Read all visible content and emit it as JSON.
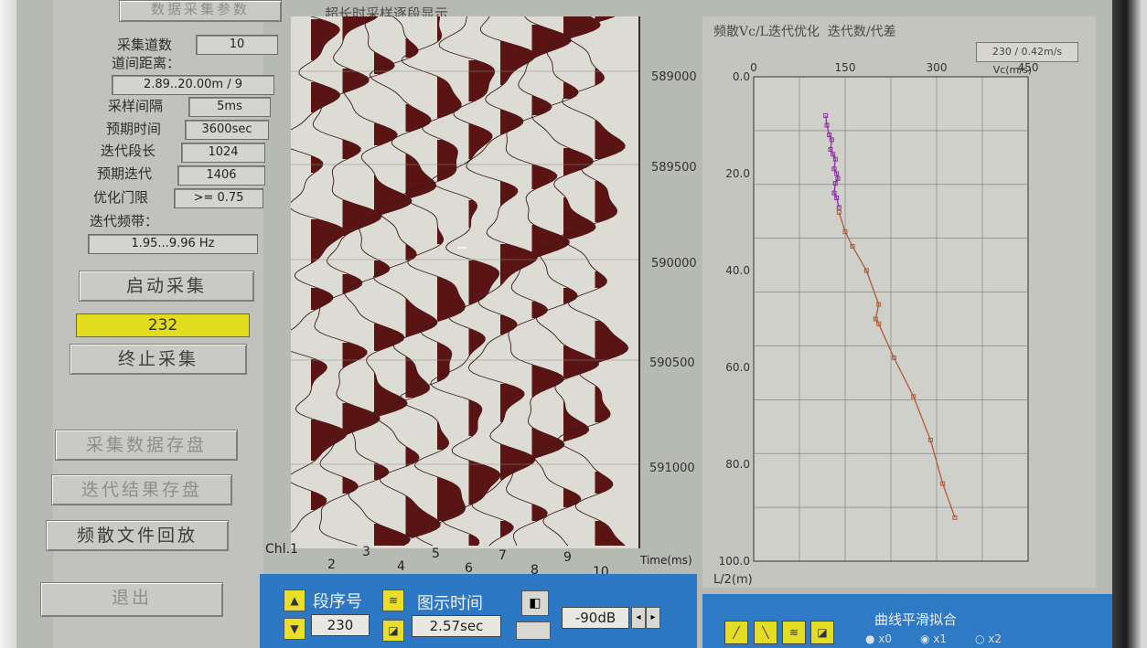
{
  "left_panel": {
    "top_button": "数据采集参数",
    "channels_label": "采集道数",
    "channels_value": "10",
    "spacing_label": "道间距离：",
    "spacing_value": "2.89..20.00m / 9",
    "sample_label": "采样间隔",
    "sample_value": "5ms",
    "expected_time_label": "预期时间",
    "expected_time_value": "3600sec",
    "segment_len_label": "迭代段长",
    "segment_len_value": "1024",
    "expected_iter_label": "预期迭代",
    "expected_iter_value": "1406",
    "threshold_label": "优化门限",
    "threshold_value": ">= 0.75",
    "band_label": "迭代频带：",
    "band_value": "1.95...9.96 Hz",
    "start_button": "启动采集",
    "counter": "232",
    "stop_button": "终止采集",
    "save_data_button": "采集数据存盘",
    "save_iter_button": "迭代结果存盘",
    "playback_button": "频散文件回放",
    "exit_button": "退出"
  },
  "seismic": {
    "title": "超长时采样逐段显示",
    "time_ticks": [
      "589000",
      "589500",
      "590000",
      "590500",
      "591000"
    ],
    "ch_prefix": "Chl.1",
    "channel_numbers": [
      "2",
      "3",
      "4",
      "5",
      "6",
      "7",
      "8",
      "9",
      "10"
    ],
    "time_axis_label": "Time(ms)"
  },
  "bottom": {
    "segment_label": "段序号",
    "segment_value": "230",
    "display_time_label": "图示时间",
    "display_time_value": "2.57sec",
    "db_value": "-90dB"
  },
  "chart": {
    "title": "频散Vc/L迭代优化",
    "iter_label": "迭代数/代差",
    "iter_value": "230 / 0.42m/s",
    "x_unit": "Vc(m/s)",
    "y_unit": "L/2(m)",
    "smoothing_label": "曲线平滑拟合",
    "radio_labels": [
      "x0",
      "x1",
      "x2"
    ]
  },
  "chart_data": {
    "type": "scatter",
    "x_label": "Vc(m/s)",
    "y_label": "L/2(m)",
    "xlim": [
      0,
      450
    ],
    "ylim": [
      0,
      100
    ],
    "x_ticks": [
      "0",
      "150",
      "300",
      "450"
    ],
    "y_ticks": [
      "0.0",
      "20.0",
      "40.0",
      "60.0",
      "80.0",
      "100.0"
    ],
    "grid": true,
    "series": [
      {
        "color": "#8a2fa0",
        "x": [
          118,
          120,
          124,
          128,
          126,
          130,
          134,
          132,
          136,
          138,
          134,
          132,
          136,
          140
        ],
        "y": [
          8,
          10,
          12,
          13,
          15,
          16,
          17,
          19,
          20,
          21,
          22,
          24,
          25,
          27
        ]
      },
      {
        "color": "#b05a3a",
        "x": [
          140,
          150,
          162,
          185,
          205,
          200,
          205,
          230,
          262,
          290,
          310,
          330
        ],
        "y": [
          28,
          32,
          35,
          40,
          47,
          50,
          51,
          58,
          66,
          75,
          84,
          91
        ]
      }
    ]
  }
}
